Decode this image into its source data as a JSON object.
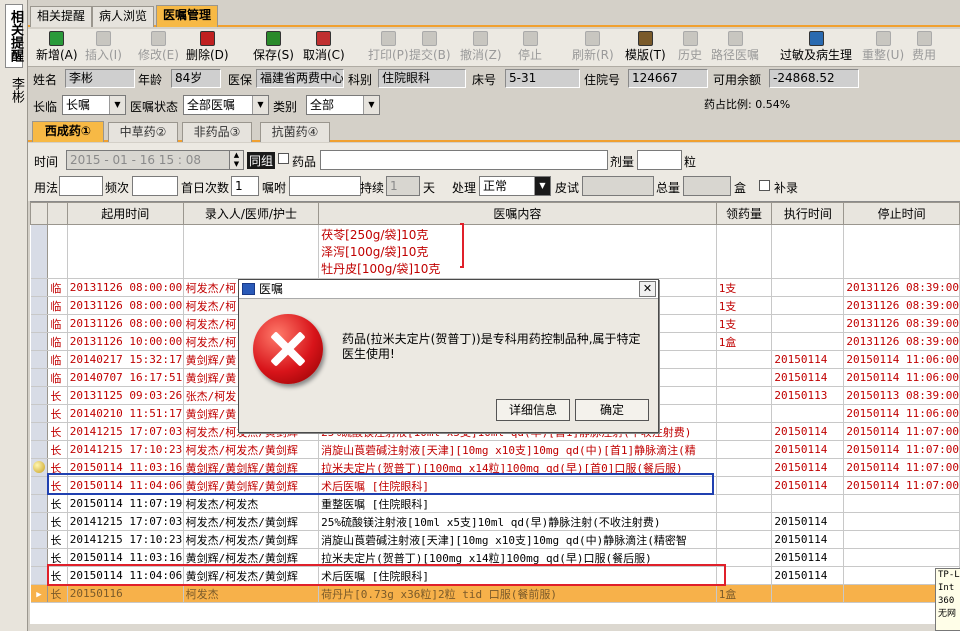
{
  "side_nav": {
    "tab1": "相关提醒",
    "tab2": "李彬"
  },
  "main_tabs": [
    {
      "label": "相关提醒",
      "active": false
    },
    {
      "label": "病人浏览",
      "active": false
    },
    {
      "label": "医嘱管理",
      "active": true
    }
  ],
  "toolbar": [
    {
      "label": "新增(A)",
      "icon": "add-icon",
      "enabled": true
    },
    {
      "label": "插入(I)",
      "icon": "insert-icon",
      "enabled": false
    },
    {
      "label": "修改(E)",
      "icon": "edit-icon",
      "enabled": false
    },
    {
      "label": "删除(D)",
      "icon": "delete-icon",
      "enabled": true
    },
    {
      "label": "保存(S)",
      "icon": "save-icon",
      "enabled": true
    },
    {
      "label": "取消(C)",
      "icon": "cancel-icon",
      "enabled": true
    },
    {
      "label": "打印(P)",
      "icon": "print-icon",
      "enabled": false
    },
    {
      "label": "提交(B)",
      "icon": "submit-icon",
      "enabled": false
    },
    {
      "label": "撤消(Z)",
      "icon": "undo-icon",
      "enabled": false
    },
    {
      "label": "停止",
      "icon": "stop-icon",
      "enabled": false
    },
    {
      "label": "刷新(R)",
      "icon": "refresh-icon",
      "enabled": false
    },
    {
      "label": "模版(T)",
      "icon": "template-icon",
      "enabled": true
    },
    {
      "label": "历史",
      "icon": "history-icon",
      "enabled": false
    },
    {
      "label": "路径医嘱",
      "icon": "pathway-icon",
      "enabled": false
    },
    {
      "label": "过敏及病生理",
      "icon": "allergy-icon",
      "enabled": true
    },
    {
      "label": "重整(U)",
      "icon": "reorganize-icon",
      "enabled": false
    },
    {
      "label": "费用",
      "icon": "cost-icon",
      "enabled": false
    }
  ],
  "patient": {
    "name_label": "姓名",
    "name": "李彬",
    "age_label": "年龄",
    "age": "84岁",
    "insurance_label": "医保",
    "insurance": "福建省两费中心",
    "dept_label": "科别",
    "dept": "住院眼科",
    "bed_label": "床号",
    "bed": "5-31",
    "admission_label": "住院号",
    "admission": "124667",
    "balance_label": "可用余额",
    "balance": "-24868.52"
  },
  "filter": {
    "duration_label": "长临",
    "duration": "长嘱",
    "status_label": "医嘱状态",
    "status": "全部医嘱",
    "category_label": "类别",
    "category": "全部",
    "drug_ratio": "药占比例: 0.54%"
  },
  "sub_tabs": [
    {
      "label": "西成药①",
      "active": true
    },
    {
      "label": "中草药②",
      "active": false
    },
    {
      "label": "非药品③",
      "active": false
    },
    {
      "label": "抗菌药④",
      "active": false
    }
  ],
  "form": {
    "time_label": "时间",
    "time_value": "2015 - 01 - 16   15 : 08",
    "same_group_label": "同组",
    "drug_label": "药品",
    "dose_label": "剂量",
    "dose_unit": "粒",
    "usage_label": "用法",
    "frequency_label": "频次",
    "first_day_label": "首日次数",
    "first_day_value": "1",
    "instruction_label": "嘱咐",
    "duration_label": "持续",
    "duration_value": "1",
    "duration_unit": "天",
    "handling_label": "处理",
    "handling_value": "正常",
    "skin_test_label": "皮试",
    "total_label": "总量",
    "total_unit": "盒",
    "refill_label": "补录"
  },
  "grid": {
    "columns": [
      "起用时间",
      "录入人/医师/护士",
      "医嘱内容",
      "领药量",
      "执行时间",
      "停止时间"
    ],
    "herb_lines": [
      "茯苓[250g/袋]10克",
      "泽泻[100g/袋]10克",
      "牡丹皮[100g/袋]10克"
    ],
    "rows": [
      {
        "type": "临",
        "start": "20131126 08:00:00",
        "staff": "柯发杰/柯",
        "content": "滴眼",
        "qty": "1支",
        "exec": "",
        "stop": "20131126 08:39:00",
        "style": "red"
      },
      {
        "type": "临",
        "start": "20131126 08:00:00",
        "staff": "柯发杰/柯",
        "content": "",
        "qty": "1支",
        "exec": "",
        "stop": "20131126 08:39:00",
        "style": "red"
      },
      {
        "type": "临",
        "start": "20131126 08:00:00",
        "staff": "柯发杰/柯",
        "content": "",
        "qty": "1支",
        "exec": "",
        "stop": "20131126 08:39:00",
        "style": "red"
      },
      {
        "type": "临",
        "start": "20131126 10:00:00",
        "staff": "柯发杰/柯",
        "content": "",
        "qty": "1盒",
        "exec": "",
        "stop": "20131126 08:39:00",
        "style": "red"
      },
      {
        "type": "临",
        "start": "20140217 15:32:17",
        "staff": "黄剑辉/黄",
        "content": "",
        "qty": "",
        "exec": "20150114",
        "stop": "20150114 11:06:00",
        "style": "red"
      },
      {
        "type": "临",
        "start": "20140707 16:17:51",
        "staff": "黄剑辉/黄",
        "content": "",
        "qty": "",
        "exec": "20150114",
        "stop": "20150114 11:06:00",
        "style": "red"
      },
      {
        "type": "长",
        "start": "20131125 09:03:26",
        "staff": "张杰/柯发",
        "content": "",
        "qty": "",
        "exec": "20150113",
        "stop": "20150113 08:39:00",
        "style": "red"
      },
      {
        "type": "长",
        "start": "20140210 11:51:17",
        "staff": "黄剑辉/黄",
        "content": "不收注射费)",
        "qty": "",
        "exec": "",
        "stop": "20150114 11:06:00",
        "style": "red"
      },
      {
        "type": "长",
        "start": "20141215 17:07:03",
        "staff": "柯发杰/柯发杰/黄剑辉",
        "content": "25%硫酸镁注射液[10ml x5支]10ml  qd(早)[首1]静脉注射(不收注射费)",
        "qty": "",
        "exec": "20150114",
        "stop": "20150114 11:07:00",
        "style": "red"
      },
      {
        "type": "长",
        "start": "20141215 17:10:23",
        "staff": "柯发杰/柯发杰/黄剑辉",
        "content": "消旋山莨菪碱注射液[天津][10mg x10支]10mg  qd(中)[首1]静脉滴注(精",
        "qty": "",
        "exec": "20150114",
        "stop": "20150114 11:07:00",
        "style": "red"
      },
      {
        "type": "长",
        "start": "20150114 11:03:16",
        "staff": "黄剑辉/黄剑辉/黄剑辉",
        "content": "拉米夫定片(贺普丁)[100mg x14粒]100mg  qd(早)[首0]口服(餐后服)",
        "qty": "",
        "exec": "20150114",
        "stop": "20150114 11:07:00",
        "style": "red",
        "pointer": true
      },
      {
        "type": "长",
        "start": "20150114 11:04:06",
        "staff": "黄剑辉/黄剑辉/黄剑辉",
        "content": "术后医嘱  [住院眼科]",
        "qty": "",
        "exec": "20150114",
        "stop": "20150114 11:07:00",
        "style": "red"
      },
      {
        "type": "长",
        "start": "20150114 11:07:19",
        "staff": "柯发杰/柯发杰",
        "content": "重整医嘱  [住院眼科]",
        "qty": "",
        "exec": "",
        "stop": "",
        "style": "black"
      },
      {
        "type": "长",
        "start": "20141215 17:07:03",
        "staff": "柯发杰/柯发杰/黄剑辉",
        "content": "25%硫酸镁注射液[10ml x5支]10ml  qd(早)静脉注射(不收注射费)",
        "qty": "",
        "exec": "20150114",
        "stop": "",
        "style": "black"
      },
      {
        "type": "长",
        "start": "20141215 17:10:23",
        "staff": "柯发杰/柯发杰/黄剑辉",
        "content": "消旋山莨菪碱注射液[天津][10mg x10支]10mg  qd(中)静脉滴注(精密智",
        "qty": "",
        "exec": "20150114",
        "stop": "",
        "style": "black"
      },
      {
        "type": "长",
        "start": "20150114 11:03:16",
        "staff": "黄剑辉/柯发杰/黄剑辉",
        "content": "拉米夫定片(贺普丁)[100mg x14粒]100mg  qd(早)口服(餐后服)",
        "qty": "",
        "exec": "20150114",
        "stop": "",
        "style": "black"
      },
      {
        "type": "长",
        "start": "20150114 11:04:06",
        "staff": "黄剑辉/柯发杰/黄剑辉",
        "content": "术后医嘱  [住院眼科]",
        "qty": "",
        "exec": "20150114",
        "stop": "",
        "style": "black"
      },
      {
        "type": "长",
        "start": "20150116",
        "staff": "柯发杰",
        "content": "荷丹片[0.73g x36粒]2粒  tid 口服(餐前服)",
        "qty": "1盒",
        "exec": "",
        "stop": "",
        "style": "hl",
        "arrow": true
      }
    ]
  },
  "dialog": {
    "title": "医嘱",
    "message": "药品(拉米夫定片(贺普丁))是专科用药控制品种,属于特定医生使用!",
    "details_button": "详细信息",
    "ok_button": "确定",
    "close_glyph": "✕"
  },
  "tooltip": {
    "lines": [
      "TP-L",
      "Int",
      "360",
      "无网"
    ]
  },
  "colors": {
    "accent": "#f7b945",
    "red_text": "#c00000",
    "highlight_row": "#f7b14a",
    "mark_red": "#e0202a",
    "mark_blue": "#2040b0"
  }
}
